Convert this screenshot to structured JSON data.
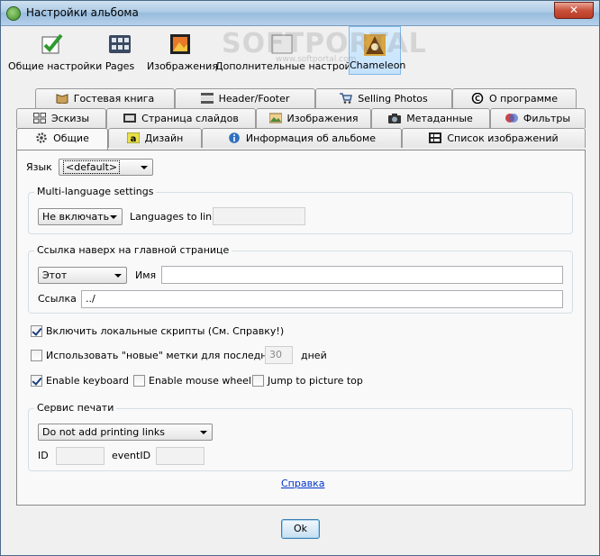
{
  "window": {
    "title": "Настройки альбома",
    "close_label": "✕"
  },
  "toolbar": {
    "items": [
      {
        "label": "Общие настройки",
        "icon": "checklist-icon"
      },
      {
        "label": "Pages",
        "icon": "pages-grid-icon"
      },
      {
        "label": "Изображения",
        "icon": "photo-icon"
      },
      {
        "label": "Дополнительные настройки",
        "icon": "advanced-settings-icon"
      },
      {
        "label": "Chameleon",
        "icon": "chameleon-icon"
      }
    ],
    "active": "Chameleon"
  },
  "tabs": {
    "row1": [
      "Гостевая книга",
      "Header/Footer",
      "Selling Photos",
      "О программе"
    ],
    "row2": [
      "Эскизы",
      "Страница слайдов",
      "Изображения",
      "Метаданные",
      "Фильтры"
    ],
    "row3": [
      "Общие",
      "Дизайн",
      "Информация об альбоме",
      "Список изображений"
    ],
    "selected": "Общие"
  },
  "general": {
    "language_label": "Язык",
    "language_value": "<default>",
    "multilang": {
      "title": "Multi-language settings",
      "mode_value": "Не включать",
      "link_label": "Languages to link",
      "link_value": ""
    },
    "uplink": {
      "title": "Ссылка наверх на главной странице",
      "target_value": "Этот",
      "name_label": "Имя",
      "name_value": "",
      "link_label": "Ссылка",
      "link_value": "../"
    },
    "local_scripts_label": "Включить локальные скрипты (См. Справку!)",
    "local_scripts_checked": true,
    "new_marks_label": "Использовать \"новые\" метки для последнего",
    "new_marks_checked": false,
    "new_marks_days": "30",
    "days_label": "дней",
    "keyboard_label": "Enable keyboard",
    "keyboard_checked": true,
    "mousewheel_label": "Enable mouse wheel",
    "mousewheel_checked": false,
    "jump_label": "Jump to picture top",
    "jump_checked": false,
    "print": {
      "title": "Сервис печати",
      "mode_value": "Do not add printing links",
      "id_label": "ID",
      "id_value": "",
      "event_label": "eventID",
      "event_value": ""
    },
    "help_link": "Справка"
  },
  "ok_label": "Ok",
  "watermark": {
    "text": "SOFTPORTAL",
    "url": "www.softportal.com"
  }
}
